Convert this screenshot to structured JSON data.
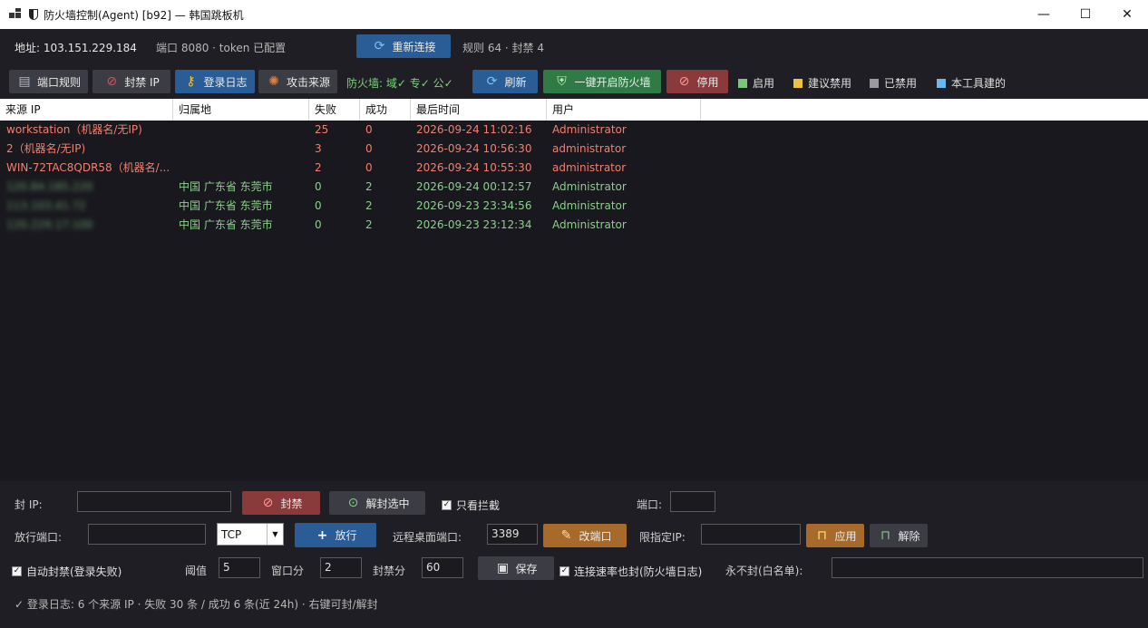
{
  "window": {
    "title": "防火墙控制(Agent) [b92] — 韩国跳板机",
    "min": "—",
    "max": "☐",
    "close": "✕"
  },
  "info": {
    "address": "地址: 103.151.229.184",
    "port_token": "端口 8080 · token 已配置",
    "reconnect": "重新连接",
    "stats": "规则 64 · 封禁 4"
  },
  "toolbar": {
    "port_rules": "端口规则",
    "ban_ip": "封禁 IP",
    "login_log": "登录日志",
    "attack_source": "攻击来源",
    "fw_status": "防火墙: 域✓  专✓  公✓",
    "refresh": "刷新",
    "enable_fw": "一键开启防火墙",
    "disable": "停用",
    "legend": [
      {
        "label": "启用",
        "color": "#7ac77a"
      },
      {
        "label": "建议禁用",
        "color": "#f0c040"
      },
      {
        "label": "已禁用",
        "color": "#9a9aa2"
      },
      {
        "label": "本工具建的",
        "color": "#6ab8f0"
      }
    ]
  },
  "table": {
    "headers": [
      "来源 IP",
      "归属地",
      "失败",
      "成功",
      "最后时间",
      "用户"
    ],
    "rows": [
      {
        "ip": "workstation（机器名/无IP)",
        "loc": "",
        "fail": "25",
        "ok": "0",
        "time": "2026-09-24 11:02:16",
        "user": "Administrator",
        "color": "red",
        "blur": false
      },
      {
        "ip": "2（机器名/无IP)",
        "loc": "",
        "fail": "3",
        "ok": "0",
        "time": "2026-09-24 10:56:30",
        "user": "administrator",
        "color": "red",
        "blur": false
      },
      {
        "ip": "WIN-72TAC8QDR58（机器名/...",
        "loc": "",
        "fail": "2",
        "ok": "0",
        "time": "2026-09-24 10:55:30",
        "user": "administrator",
        "color": "red",
        "blur": false
      },
      {
        "ip": "120.84.185.220",
        "loc": "中国 广东省 东莞市",
        "fail": "0",
        "ok": "2",
        "time": "2026-09-24 00:12:57",
        "user": "Administrator",
        "color": "green",
        "blur": true
      },
      {
        "ip": "113.103.41.72",
        "loc": "中国 广东省 东莞市",
        "fail": "0",
        "ok": "2",
        "time": "2026-09-23 23:34:56",
        "user": "Administrator",
        "color": "green",
        "blur": true
      },
      {
        "ip": "120.229.17.100",
        "loc": "中国 广东省 东莞市",
        "fail": "0",
        "ok": "2",
        "time": "2026-09-23 23:12:34",
        "user": "Administrator",
        "color": "green",
        "blur": true
      }
    ]
  },
  "panel": {
    "ban_ip_label": "封 IP:",
    "ban_btn": "封禁",
    "unban_btn": "解封选中",
    "only_blocked": "只看拦截",
    "port_label": "端口:",
    "allow_port_label": "放行端口:",
    "protocol": "TCP",
    "allow_btn": "放行",
    "rdp_port_label": "远程桌面端口:",
    "rdp_port": "3389",
    "change_port_btn": "改端口",
    "limit_ip_label": "限指定IP:",
    "apply_btn": "应用",
    "release_btn": "解除",
    "auto_ban": "自动封禁(登录失败)",
    "threshold_label": "阈值",
    "threshold": "5",
    "window_label": "窗口分",
    "window_min": "2",
    "ban_min_label": "封禁分",
    "ban_min": "60",
    "save_btn": "保存",
    "rate_ban": "连接速率也封(防火墙日志)",
    "whitelist_label": "永不封(白名单):",
    "status": "✓ 登录日志: 6 个来源 IP · 失败 30 条 / 成功 6 条(近 24h) · 右键可封/解封"
  }
}
